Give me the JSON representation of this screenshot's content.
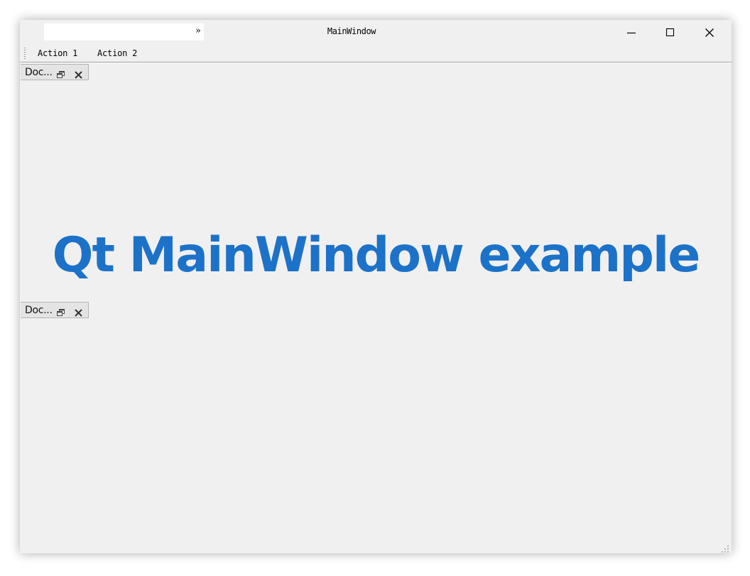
{
  "window": {
    "title": "MainWindow"
  },
  "menubar": {
    "extension_label": "»"
  },
  "title_buttons": {
    "minimize": "minimize-icon",
    "maximize": "maximize-icon",
    "close": "close-icon"
  },
  "toolbar": {
    "action1_label": "Action 1",
    "action2_label": "Action 2"
  },
  "docks": [
    {
      "title": "Doc..."
    },
    {
      "title": "Doc..."
    }
  ],
  "central": {
    "text": "Qt MainWindow example",
    "color": "#1c72c8"
  },
  "colors": {
    "window_bg": "#f0f0f0",
    "accent": "#1c72c8"
  }
}
